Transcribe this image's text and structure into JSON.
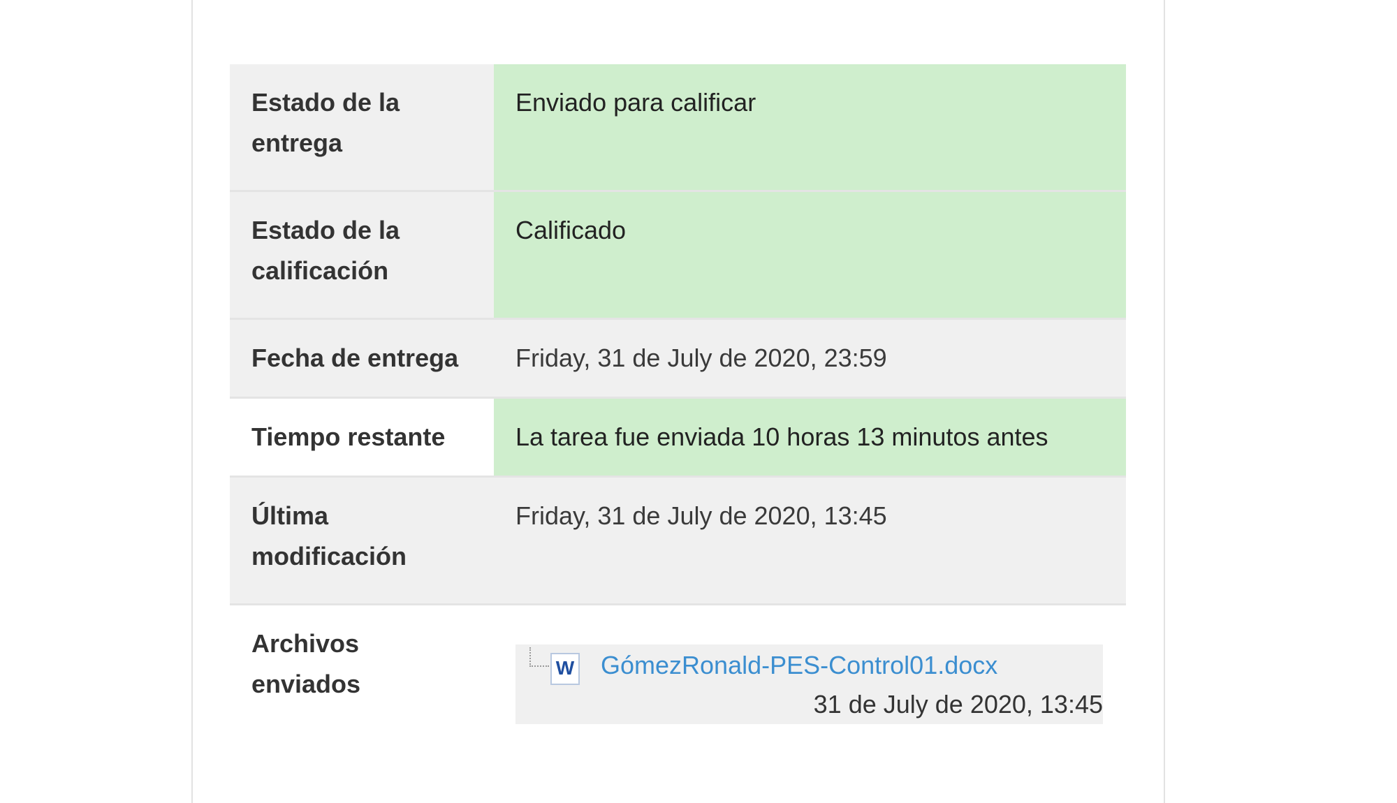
{
  "rows": [
    {
      "label": "Estado de la entrega",
      "value": "Enviado para calificar"
    },
    {
      "label": "Estado de la calificación",
      "value": "Calificado"
    },
    {
      "label": "Fecha de entrega",
      "value": "Friday, 31 de July de 2020, 23:59"
    },
    {
      "label": "Tiempo restante",
      "value": "La tarea fue enviada 10 horas 13 minutos antes"
    },
    {
      "label": "Última modificación",
      "value": "Friday, 31 de July de 2020, 13:45"
    },
    {
      "label": "Archivos enviados"
    }
  ],
  "file": {
    "name": "GómezRonald-PES-Control01.docx",
    "date": "31 de July de 2020, 13:45",
    "icon": "word-document-icon",
    "icon_letter": "W"
  },
  "colors": {
    "success": "#cfeecd",
    "label_bg": "#f0f0f0",
    "link": "#3b8ed0"
  }
}
